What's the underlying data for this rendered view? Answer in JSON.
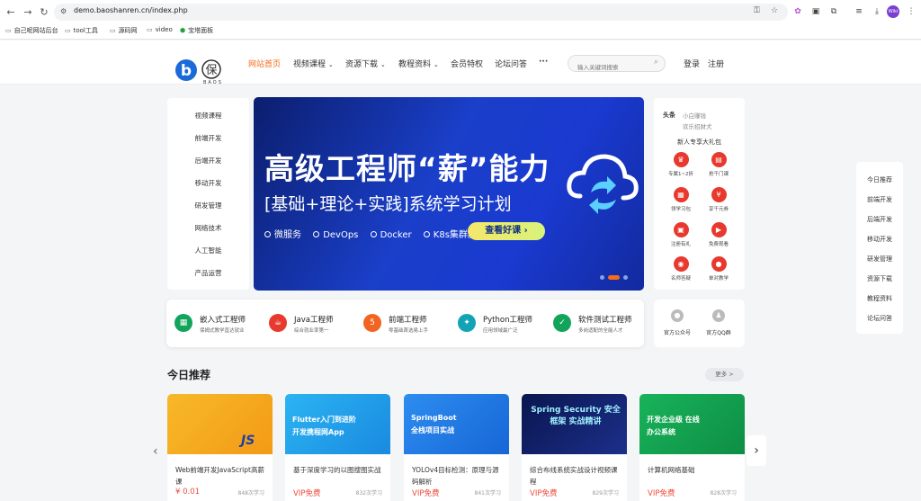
{
  "browser": {
    "url": "demo.baoshanren.cn/index.php",
    "bookmarks": [
      "自己呢网站后台",
      "tool工具",
      "源码网",
      "video",
      "宝塔面板"
    ],
    "profile_avatar": "Wiki"
  },
  "colors": {
    "brand": "#f56a1b",
    "price": "#f04a3b",
    "link_blue": "#1a6bd8"
  },
  "header": {
    "logo_text": "BAOS",
    "nav": [
      {
        "label": "网站首页",
        "active": true,
        "dropdown": false
      },
      {
        "label": "视频课程",
        "active": false,
        "dropdown": true
      },
      {
        "label": "资源下载",
        "active": false,
        "dropdown": true
      },
      {
        "label": "教程资料",
        "active": false,
        "dropdown": true
      },
      {
        "label": "会员特权",
        "active": false,
        "dropdown": false
      },
      {
        "label": "论坛问答",
        "active": false,
        "dropdown": false
      }
    ],
    "more_icon": "···",
    "search_placeholder": "输入关键词搜索",
    "login": "登录",
    "register": "注册"
  },
  "categories": [
    "视频课程",
    "前端开发",
    "后端开发",
    "移动开发",
    "研发管理",
    "网络技术",
    "人工智能",
    "产品运营"
  ],
  "banner": {
    "title": "高级工程师“薪”能力",
    "subtitle": "[基础+理论+实践]系统学习计划",
    "tags": [
      "微服务",
      "DevOps",
      "Docker",
      "K8s集群服务"
    ],
    "cta": "查看好课 ›",
    "active_slide": 2,
    "slides": 4
  },
  "right_panel": {
    "headline_label": "头条",
    "news": [
      "小白赚钱",
      "欢乐招财犬"
    ],
    "gift_title": "新人专享大礼包",
    "gifts": [
      "专属1~2折",
      "抢千门课",
      "领学习包",
      "享千元券",
      "注册有礼",
      "免费观看",
      "名师答疑",
      "单对教学"
    ]
  },
  "occupations": [
    {
      "name": "嵌入式工程师",
      "desc": "保姆式教学直达就业",
      "icon": "chip-icon",
      "color": "#13a45c"
    },
    {
      "name": "Java工程师",
      "desc": "综合就业率第一",
      "icon": "java-icon",
      "color": "#e8392e"
    },
    {
      "name": "前端工程师",
      "desc": "零基础首选易上手",
      "icon": "html5-icon",
      "color": "#f26422"
    },
    {
      "name": "Python工程师",
      "desc": "应用领域最广泛",
      "icon": "python-icon",
      "color": "#12a3b5"
    },
    {
      "name": "软件测试工程师",
      "desc": "多岗适配的全能人才",
      "icon": "test-icon",
      "color": "#13a45c"
    }
  ],
  "qr": [
    {
      "label": "官方公众号",
      "icon": "wechat-icon"
    },
    {
      "label": "官方QQ群",
      "icon": "qq-icon"
    }
  ],
  "recommend": {
    "title": "今日推荐",
    "more": "更多 >",
    "cards": [
      {
        "title": "Web前端开发JavaScript高薪课",
        "price": "¥ 0.01",
        "count": "848次学习",
        "img_text": "JS",
        "bg": "#f5a623"
      },
      {
        "title": "基于深度学习的以图搜图实战",
        "price": "VIP免费",
        "count": "832次学习",
        "img_text": "Flutter入门到进阶 开发携程网App",
        "bg": "#1a9ee8"
      },
      {
        "title": "YOLOv4目标检测：原理与源码解析",
        "price": "VIP免费",
        "count": "841次学习",
        "img_text": "SpringBoot 全栈项目实战",
        "bg": "#1c7be0"
      },
      {
        "title": "综合布线系统实战设计视频课程",
        "price": "VIP免费",
        "count": "829次学习",
        "img_text": "Spring Security 安全框架 实战精讲",
        "bg": "#0e1c5c"
      },
      {
        "title": "计算机网络基础",
        "price": "VIP免费",
        "count": "828次学习",
        "img_text": "开发企业级 在线办公系统",
        "bg": "#14a050"
      }
    ]
  },
  "floating_nav": [
    "今日推荐",
    "前端开发",
    "后端开发",
    "移动开发",
    "研发管理",
    "资源下载",
    "教程资料",
    "论坛问答"
  ]
}
